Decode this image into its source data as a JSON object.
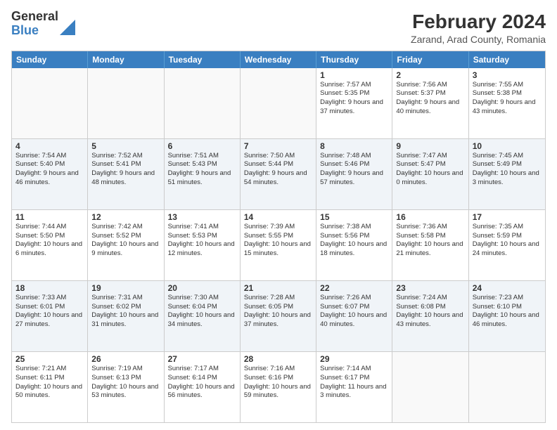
{
  "logo": {
    "general": "General",
    "blue": "Blue"
  },
  "header": {
    "title": "February 2024",
    "subtitle": "Zarand, Arad County, Romania"
  },
  "weekdays": [
    "Sunday",
    "Monday",
    "Tuesday",
    "Wednesday",
    "Thursday",
    "Friday",
    "Saturday"
  ],
  "rows": [
    [
      {
        "day": "",
        "info": ""
      },
      {
        "day": "",
        "info": ""
      },
      {
        "day": "",
        "info": ""
      },
      {
        "day": "",
        "info": ""
      },
      {
        "day": "1",
        "info": "Sunrise: 7:57 AM\nSunset: 5:35 PM\nDaylight: 9 hours and 37 minutes."
      },
      {
        "day": "2",
        "info": "Sunrise: 7:56 AM\nSunset: 5:37 PM\nDaylight: 9 hours and 40 minutes."
      },
      {
        "day": "3",
        "info": "Sunrise: 7:55 AM\nSunset: 5:38 PM\nDaylight: 9 hours and 43 minutes."
      }
    ],
    [
      {
        "day": "4",
        "info": "Sunrise: 7:54 AM\nSunset: 5:40 PM\nDaylight: 9 hours and 46 minutes."
      },
      {
        "day": "5",
        "info": "Sunrise: 7:52 AM\nSunset: 5:41 PM\nDaylight: 9 hours and 48 minutes."
      },
      {
        "day": "6",
        "info": "Sunrise: 7:51 AM\nSunset: 5:43 PM\nDaylight: 9 hours and 51 minutes."
      },
      {
        "day": "7",
        "info": "Sunrise: 7:50 AM\nSunset: 5:44 PM\nDaylight: 9 hours and 54 minutes."
      },
      {
        "day": "8",
        "info": "Sunrise: 7:48 AM\nSunset: 5:46 PM\nDaylight: 9 hours and 57 minutes."
      },
      {
        "day": "9",
        "info": "Sunrise: 7:47 AM\nSunset: 5:47 PM\nDaylight: 10 hours and 0 minutes."
      },
      {
        "day": "10",
        "info": "Sunrise: 7:45 AM\nSunset: 5:49 PM\nDaylight: 10 hours and 3 minutes."
      }
    ],
    [
      {
        "day": "11",
        "info": "Sunrise: 7:44 AM\nSunset: 5:50 PM\nDaylight: 10 hours and 6 minutes."
      },
      {
        "day": "12",
        "info": "Sunrise: 7:42 AM\nSunset: 5:52 PM\nDaylight: 10 hours and 9 minutes."
      },
      {
        "day": "13",
        "info": "Sunrise: 7:41 AM\nSunset: 5:53 PM\nDaylight: 10 hours and 12 minutes."
      },
      {
        "day": "14",
        "info": "Sunrise: 7:39 AM\nSunset: 5:55 PM\nDaylight: 10 hours and 15 minutes."
      },
      {
        "day": "15",
        "info": "Sunrise: 7:38 AM\nSunset: 5:56 PM\nDaylight: 10 hours and 18 minutes."
      },
      {
        "day": "16",
        "info": "Sunrise: 7:36 AM\nSunset: 5:58 PM\nDaylight: 10 hours and 21 minutes."
      },
      {
        "day": "17",
        "info": "Sunrise: 7:35 AM\nSunset: 5:59 PM\nDaylight: 10 hours and 24 minutes."
      }
    ],
    [
      {
        "day": "18",
        "info": "Sunrise: 7:33 AM\nSunset: 6:01 PM\nDaylight: 10 hours and 27 minutes."
      },
      {
        "day": "19",
        "info": "Sunrise: 7:31 AM\nSunset: 6:02 PM\nDaylight: 10 hours and 31 minutes."
      },
      {
        "day": "20",
        "info": "Sunrise: 7:30 AM\nSunset: 6:04 PM\nDaylight: 10 hours and 34 minutes."
      },
      {
        "day": "21",
        "info": "Sunrise: 7:28 AM\nSunset: 6:05 PM\nDaylight: 10 hours and 37 minutes."
      },
      {
        "day": "22",
        "info": "Sunrise: 7:26 AM\nSunset: 6:07 PM\nDaylight: 10 hours and 40 minutes."
      },
      {
        "day": "23",
        "info": "Sunrise: 7:24 AM\nSunset: 6:08 PM\nDaylight: 10 hours and 43 minutes."
      },
      {
        "day": "24",
        "info": "Sunrise: 7:23 AM\nSunset: 6:10 PM\nDaylight: 10 hours and 46 minutes."
      }
    ],
    [
      {
        "day": "25",
        "info": "Sunrise: 7:21 AM\nSunset: 6:11 PM\nDaylight: 10 hours and 50 minutes."
      },
      {
        "day": "26",
        "info": "Sunrise: 7:19 AM\nSunset: 6:13 PM\nDaylight: 10 hours and 53 minutes."
      },
      {
        "day": "27",
        "info": "Sunrise: 7:17 AM\nSunset: 6:14 PM\nDaylight: 10 hours and 56 minutes."
      },
      {
        "day": "28",
        "info": "Sunrise: 7:16 AM\nSunset: 6:16 PM\nDaylight: 10 hours and 59 minutes."
      },
      {
        "day": "29",
        "info": "Sunrise: 7:14 AM\nSunset: 6:17 PM\nDaylight: 11 hours and 3 minutes."
      },
      {
        "day": "",
        "info": ""
      },
      {
        "day": "",
        "info": ""
      }
    ]
  ]
}
